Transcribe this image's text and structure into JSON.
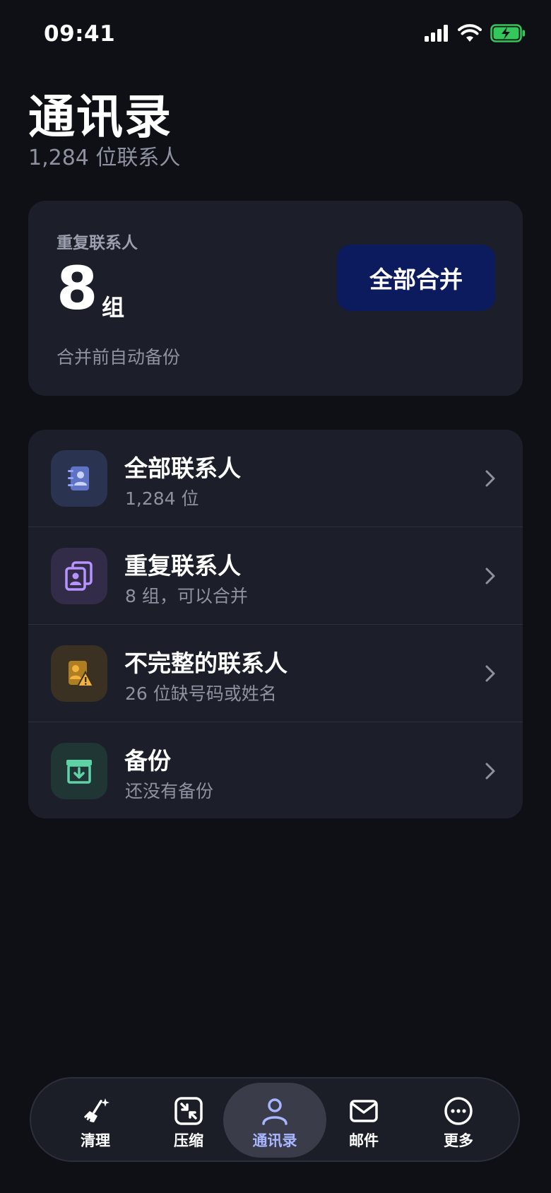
{
  "status_bar": {
    "time": "09:41"
  },
  "header": {
    "title": "通讯录",
    "subtitle": "1,284 位联系人"
  },
  "summary": {
    "label": "重复联系人",
    "count": "8",
    "unit": "组",
    "note": "合并前自动备份",
    "merge_button": "全部合并"
  },
  "list": {
    "items": [
      {
        "title": "全部联系人",
        "subtitle": "1,284 位",
        "icon": "address-book-icon",
        "icon_color": "#8ea3ff",
        "bg": "#2a3350"
      },
      {
        "title": "重复联系人",
        "subtitle": "8 组，可以合并",
        "icon": "duplicate-contact-icon",
        "icon_color": "#b793ff",
        "bg": "#322c48"
      },
      {
        "title": "不完整的联系人",
        "subtitle": "26 位缺号码或姓名",
        "icon": "contact-warning-icon",
        "icon_color": "#f2b23d",
        "bg": "#3a3122"
      },
      {
        "title": "备份",
        "subtitle": "还没有备份",
        "icon": "archive-download-icon",
        "icon_color": "#5fd3a8",
        "bg": "#1f3634"
      }
    ]
  },
  "tabs": [
    {
      "label": "清理",
      "icon": "broom-sparkle-icon",
      "active": false
    },
    {
      "label": "压缩",
      "icon": "compress-icon",
      "active": false
    },
    {
      "label": "通讯录",
      "icon": "person-icon",
      "active": true
    },
    {
      "label": "邮件",
      "icon": "mail-icon",
      "active": false
    },
    {
      "label": "更多",
      "icon": "more-icon",
      "active": false
    }
  ],
  "colors": {
    "background": "#0f1016",
    "card": "#1c1e29",
    "accent_button": "#0c1a5e",
    "active_tab_text": "#a8b6ff",
    "battery": "#34c759"
  }
}
